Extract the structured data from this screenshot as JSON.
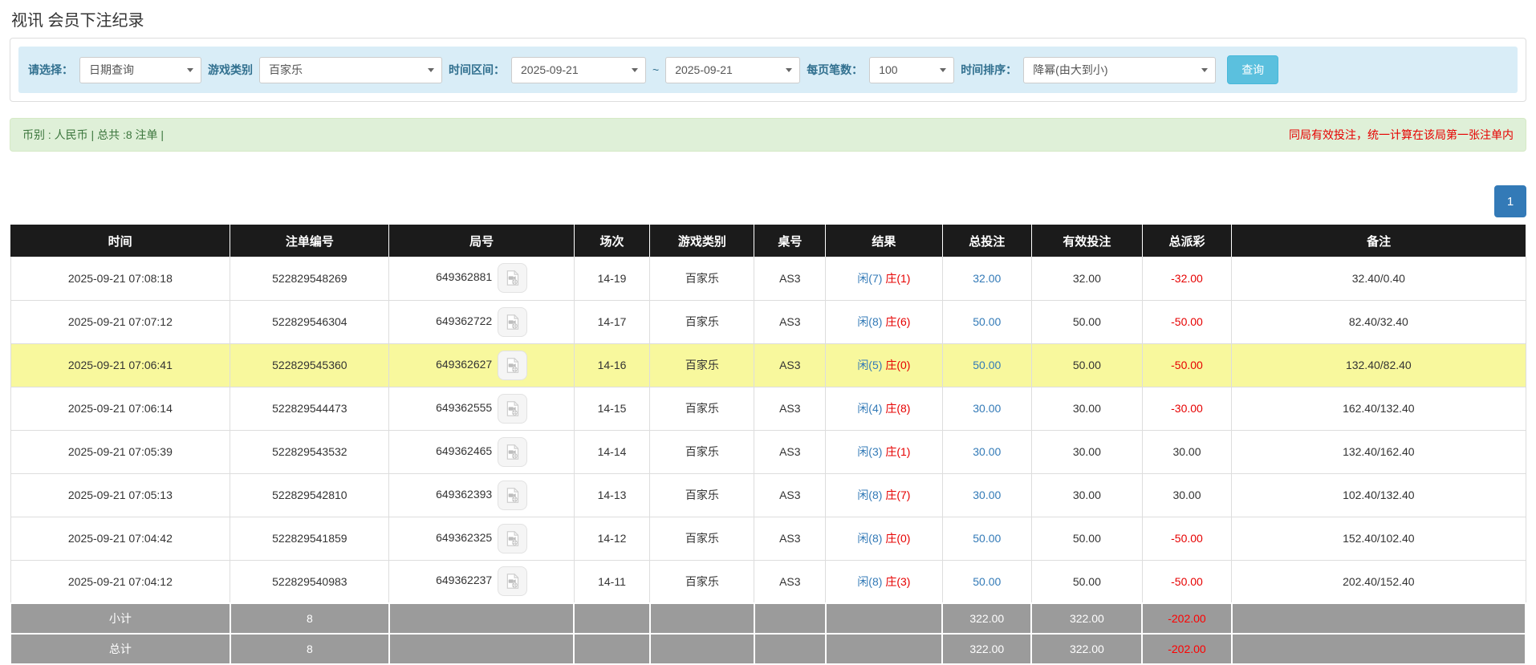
{
  "page": {
    "title": "视讯 会员下注纪录"
  },
  "filters": {
    "select_label": "请选择：",
    "select_value": "日期查询",
    "game_type_label": "游戏类别",
    "game_type_value": "百家乐",
    "date_range_label": "时间区间：",
    "date_from": "2025-09-21",
    "tilde": "~",
    "date_to": "2025-09-21",
    "page_size_label": "每页笔数：",
    "page_size_value": "100",
    "sort_label": "时间排序：",
    "sort_value": "降幂(由大到小)",
    "search_button": "查询"
  },
  "summary": {
    "left": "币别 : 人民币 | 总共 :8 注单 |",
    "right_note": "同局有效投注，统一计算在该局第一张注单内"
  },
  "pagination": {
    "current": "1"
  },
  "icons": {
    "dropdown": "chevron-down-icon",
    "round_video": "video-replay-icon"
  },
  "colors": {
    "header_bg": "#1b1b1b",
    "footer_bg": "#9b9b9b",
    "highlight_row": "#f8f89d",
    "link_blue": "#337ab7",
    "negative_red": "#e60000",
    "filter_bg": "#d9edf7",
    "summary_bg": "#dff0d8",
    "query_button_blue": "#5bc0de",
    "pagination_blue": "#337ab7"
  },
  "table": {
    "headers": [
      "时间",
      "注单编号",
      "局号",
      "场次",
      "游戏类别",
      "桌号",
      "结果",
      "总投注",
      "有效投注",
      "总派彩",
      "备注"
    ],
    "col_widths": [
      "14.5%",
      "10.5%",
      "12.2%",
      "5.0%",
      "6.9%",
      "4.7%",
      "7.7%",
      "5.9%",
      "7.3%",
      "5.9%",
      "19.4%"
    ],
    "rows": [
      {
        "time": "2025-09-21 07:08:18",
        "bet_id": "522829548269",
        "round_id": "649362881",
        "session": "14-19",
        "game": "百家乐",
        "table": "AS3",
        "result_player": "闲(7)",
        "result_banker": "庄(1)",
        "total_bet": "32.00",
        "valid_bet": "32.00",
        "payout": "-32.00",
        "remark": "32.40/0.40",
        "highlight": false
      },
      {
        "time": "2025-09-21 07:07:12",
        "bet_id": "522829546304",
        "round_id": "649362722",
        "session": "14-17",
        "game": "百家乐",
        "table": "AS3",
        "result_player": "闲(8)",
        "result_banker": "庄(6)",
        "total_bet": "50.00",
        "valid_bet": "50.00",
        "payout": "-50.00",
        "remark": "82.40/32.40",
        "highlight": false
      },
      {
        "time": "2025-09-21 07:06:41",
        "bet_id": "522829545360",
        "round_id": "649362627",
        "session": "14-16",
        "game": "百家乐",
        "table": "AS3",
        "result_player": "闲(5)",
        "result_banker": "庄(0)",
        "total_bet": "50.00",
        "valid_bet": "50.00",
        "payout": "-50.00",
        "remark": "132.40/82.40",
        "highlight": true
      },
      {
        "time": "2025-09-21 07:06:14",
        "bet_id": "522829544473",
        "round_id": "649362555",
        "session": "14-15",
        "game": "百家乐",
        "table": "AS3",
        "result_player": "闲(4)",
        "result_banker": "庄(8)",
        "total_bet": "30.00",
        "valid_bet": "30.00",
        "payout": "-30.00",
        "remark": "162.40/132.40",
        "highlight": false
      },
      {
        "time": "2025-09-21 07:05:39",
        "bet_id": "522829543532",
        "round_id": "649362465",
        "session": "14-14",
        "game": "百家乐",
        "table": "AS3",
        "result_player": "闲(3)",
        "result_banker": "庄(1)",
        "total_bet": "30.00",
        "valid_bet": "30.00",
        "payout": "30.00",
        "remark": "132.40/162.40",
        "highlight": false
      },
      {
        "time": "2025-09-21 07:05:13",
        "bet_id": "522829542810",
        "round_id": "649362393",
        "session": "14-13",
        "game": "百家乐",
        "table": "AS3",
        "result_player": "闲(8)",
        "result_banker": "庄(7)",
        "total_bet": "30.00",
        "valid_bet": "30.00",
        "payout": "30.00",
        "remark": "102.40/132.40",
        "highlight": false
      },
      {
        "time": "2025-09-21 07:04:42",
        "bet_id": "522829541859",
        "round_id": "649362325",
        "session": "14-12",
        "game": "百家乐",
        "table": "AS3",
        "result_player": "闲(8)",
        "result_banker": "庄(0)",
        "total_bet": "50.00",
        "valid_bet": "50.00",
        "payout": "-50.00",
        "remark": "152.40/102.40",
        "highlight": false
      },
      {
        "time": "2025-09-21 07:04:12",
        "bet_id": "522829540983",
        "round_id": "649362237",
        "session": "14-11",
        "game": "百家乐",
        "table": "AS3",
        "result_player": "闲(8)",
        "result_banker": "庄(3)",
        "total_bet": "50.00",
        "valid_bet": "50.00",
        "payout": "-50.00",
        "remark": "202.40/152.40",
        "highlight": false
      }
    ],
    "footer": [
      {
        "label": "小计",
        "count": "8",
        "total_bet": "322.00",
        "valid_bet": "322.00",
        "payout": "-202.00"
      },
      {
        "label": "总计",
        "count": "8",
        "total_bet": "322.00",
        "valid_bet": "322.00",
        "payout": "-202.00"
      }
    ]
  }
}
